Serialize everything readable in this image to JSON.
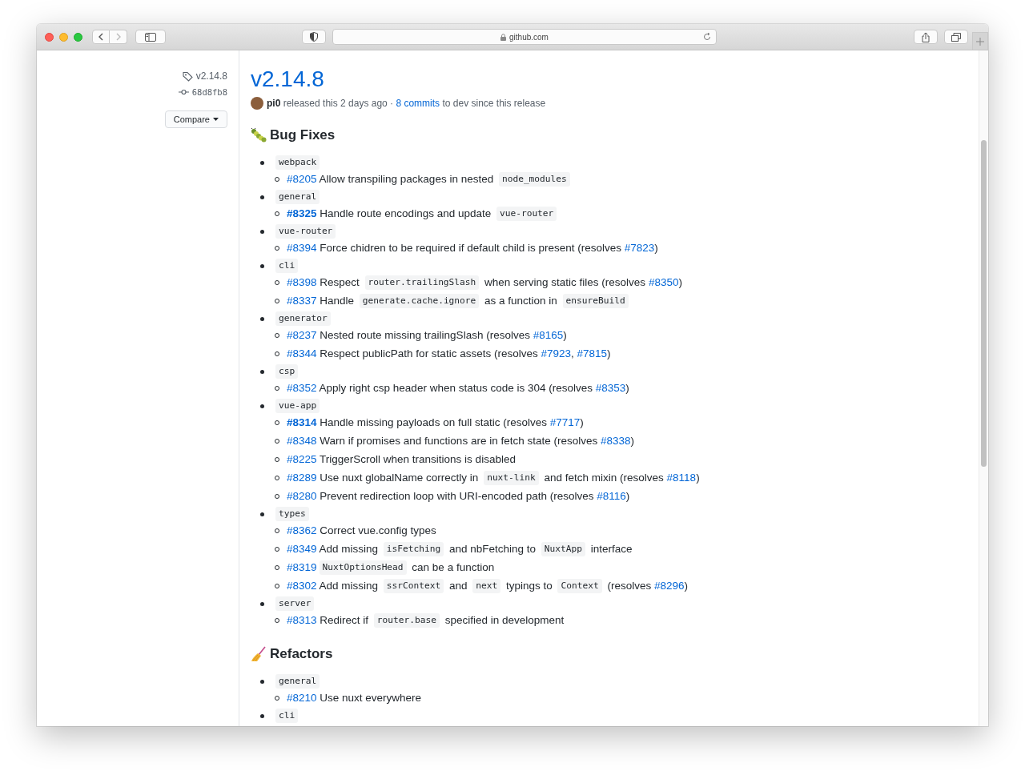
{
  "browser": {
    "url": "github.com"
  },
  "sidebar": {
    "tag": "v2.14.8",
    "commit": "68d8fb8",
    "compare_button": "Compare"
  },
  "release": {
    "title": "v2.14.8",
    "author": "pi0",
    "released_text": " released this 2 days ago · ",
    "commits_link": "8 commits",
    "commits_suffix": " to dev since this release"
  },
  "sections": [
    {
      "title": "Bug Fixes",
      "groups": [
        {
          "scope": "webpack",
          "items": [
            [
              {
                "kind": "link",
                "text": "#8205",
                "bold": false
              },
              {
                "kind": "text",
                "text": " Allow transpiling packages in nested "
              },
              {
                "kind": "code",
                "text": "node_modules"
              }
            ]
          ]
        },
        {
          "scope": "general",
          "items": [
            [
              {
                "kind": "link",
                "text": "#8325",
                "bold": true
              },
              {
                "kind": "text",
                "text": " Handle route encodings and update "
              },
              {
                "kind": "code",
                "text": "vue-router"
              }
            ]
          ]
        },
        {
          "scope": "vue-router",
          "items": [
            [
              {
                "kind": "link",
                "text": "#8394",
                "bold": false
              },
              {
                "kind": "text",
                "text": " Force chidren to be required if default child is present (resolves "
              },
              {
                "kind": "link",
                "text": "#7823",
                "bold": false
              },
              {
                "kind": "text",
                "text": ")"
              }
            ]
          ]
        },
        {
          "scope": "cli",
          "items": [
            [
              {
                "kind": "link",
                "text": "#8398",
                "bold": false
              },
              {
                "kind": "text",
                "text": " Respect "
              },
              {
                "kind": "code",
                "text": "router.trailingSlash"
              },
              {
                "kind": "text",
                "text": " when serving static files (resolves "
              },
              {
                "kind": "link",
                "text": "#8350",
                "bold": false
              },
              {
                "kind": "text",
                "text": ")"
              }
            ],
            [
              {
                "kind": "link",
                "text": "#8337",
                "bold": false
              },
              {
                "kind": "text",
                "text": " Handle "
              },
              {
                "kind": "code",
                "text": "generate.cache.ignore"
              },
              {
                "kind": "text",
                "text": " as a function in "
              },
              {
                "kind": "code",
                "text": "ensureBuild"
              }
            ]
          ]
        },
        {
          "scope": "generator",
          "items": [
            [
              {
                "kind": "link",
                "text": "#8237",
                "bold": false
              },
              {
                "kind": "text",
                "text": " Nested route missing trailingSlash (resolves "
              },
              {
                "kind": "link",
                "text": "#8165",
                "bold": false
              },
              {
                "kind": "text",
                "text": ")"
              }
            ],
            [
              {
                "kind": "link",
                "text": "#8344",
                "bold": false
              },
              {
                "kind": "text",
                "text": " Respect publicPath for static assets (resolves "
              },
              {
                "kind": "link",
                "text": "#7923",
                "bold": false
              },
              {
                "kind": "text",
                "text": ", "
              },
              {
                "kind": "link",
                "text": "#7815",
                "bold": false
              },
              {
                "kind": "text",
                "text": ")"
              }
            ]
          ]
        },
        {
          "scope": "csp",
          "items": [
            [
              {
                "kind": "link",
                "text": "#8352",
                "bold": false
              },
              {
                "kind": "text",
                "text": " Apply right csp header when status code is 304 (resolves "
              },
              {
                "kind": "link",
                "text": "#8353",
                "bold": false
              },
              {
                "kind": "text",
                "text": ")"
              }
            ]
          ]
        },
        {
          "scope": "vue-app",
          "items": [
            [
              {
                "kind": "link",
                "text": "#8314",
                "bold": true
              },
              {
                "kind": "text",
                "text": " Handle missing payloads on full static (resolves "
              },
              {
                "kind": "link",
                "text": "#7717",
                "bold": false
              },
              {
                "kind": "text",
                "text": ")"
              }
            ],
            [
              {
                "kind": "link",
                "text": "#8348",
                "bold": false
              },
              {
                "kind": "text",
                "text": " Warn if promises and functions are in fetch state (resolves "
              },
              {
                "kind": "link",
                "text": "#8338",
                "bold": false
              },
              {
                "kind": "text",
                "text": ")"
              }
            ],
            [
              {
                "kind": "link",
                "text": "#8225",
                "bold": false
              },
              {
                "kind": "text",
                "text": " TriggerScroll when transitions is disabled"
              }
            ],
            [
              {
                "kind": "link",
                "text": "#8289",
                "bold": false
              },
              {
                "kind": "text",
                "text": " Use nuxt globalName correctly in "
              },
              {
                "kind": "code",
                "text": "nuxt-link"
              },
              {
                "kind": "text",
                "text": " and fetch mixin (resolves "
              },
              {
                "kind": "link",
                "text": "#8118",
                "bold": false
              },
              {
                "kind": "text",
                "text": ")"
              }
            ],
            [
              {
                "kind": "link",
                "text": "#8280",
                "bold": false
              },
              {
                "kind": "text",
                "text": " Prevent redirection loop with URI-encoded path (resolves "
              },
              {
                "kind": "link",
                "text": "#8116",
                "bold": false
              },
              {
                "kind": "text",
                "text": ")"
              }
            ]
          ]
        },
        {
          "scope": "types",
          "items": [
            [
              {
                "kind": "link",
                "text": "#8362",
                "bold": false
              },
              {
                "kind": "text",
                "text": " Correct vue.config types"
              }
            ],
            [
              {
                "kind": "link",
                "text": "#8349",
                "bold": false
              },
              {
                "kind": "text",
                "text": " Add missing "
              },
              {
                "kind": "code",
                "text": "isFetching"
              },
              {
                "kind": "text",
                "text": " and nbFetching to "
              },
              {
                "kind": "code",
                "text": "NuxtApp"
              },
              {
                "kind": "text",
                "text": " interface"
              }
            ],
            [
              {
                "kind": "link",
                "text": "#8319",
                "bold": false
              },
              {
                "kind": "code",
                "text": "NuxtOptionsHead"
              },
              {
                "kind": "text",
                "text": " can be a function"
              }
            ],
            [
              {
                "kind": "link",
                "text": "#8302",
                "bold": false
              },
              {
                "kind": "text",
                "text": " Add missing "
              },
              {
                "kind": "code",
                "text": "ssrContext"
              },
              {
                "kind": "text",
                "text": " and "
              },
              {
                "kind": "code",
                "text": "next"
              },
              {
                "kind": "text",
                "text": " typings to "
              },
              {
                "kind": "code",
                "text": "Context"
              },
              {
                "kind": "text",
                "text": " (resolves "
              },
              {
                "kind": "link",
                "text": "#8296",
                "bold": false
              },
              {
                "kind": "text",
                "text": ")"
              }
            ]
          ]
        },
        {
          "scope": "server",
          "items": [
            [
              {
                "kind": "link",
                "text": "#8313",
                "bold": false
              },
              {
                "kind": "text",
                "text": " Redirect if "
              },
              {
                "kind": "code",
                "text": "router.base"
              },
              {
                "kind": "text",
                "text": " specified in development"
              }
            ]
          ]
        }
      ]
    },
    {
      "title": "Refactors",
      "groups": [
        {
          "scope": "general",
          "items": [
            [
              {
                "kind": "link",
                "text": "#8210",
                "bold": false
              },
              {
                "kind": "text",
                "text": " Use nuxt everywhere"
              }
            ]
          ]
        },
        {
          "scope": "cli"
        }
      ]
    }
  ]
}
